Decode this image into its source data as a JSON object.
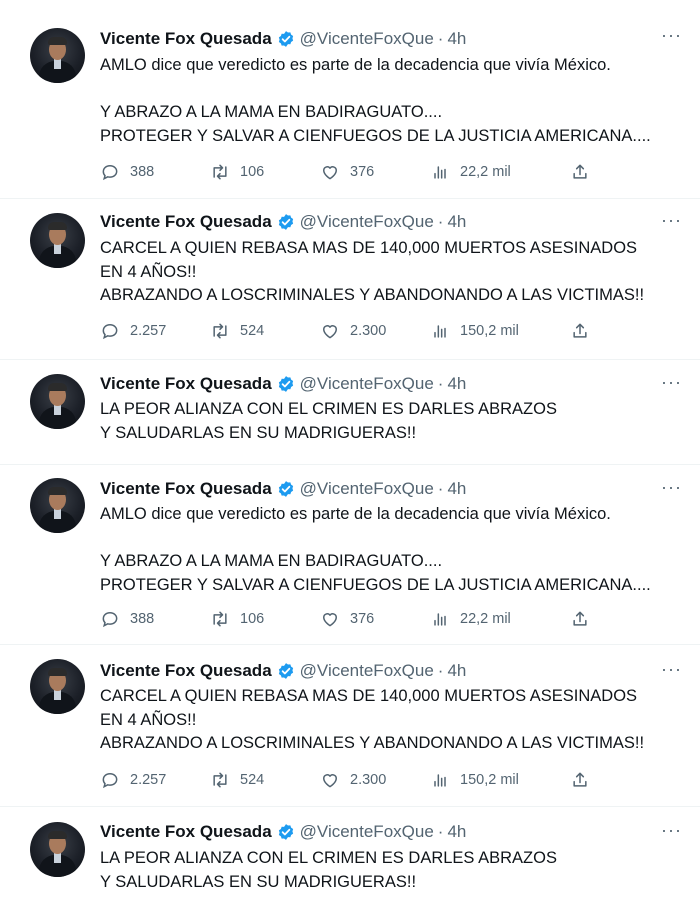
{
  "colors": {
    "text": "#0f1419",
    "muted": "#536471",
    "verified": "#1d9bf0",
    "divider": "#eff3f4"
  },
  "icons": {
    "reply": "speech-bubble-icon",
    "retweet": "retweet-arrows-icon",
    "like": "heart-icon",
    "views": "bar-chart-icon",
    "share": "share-upload-icon",
    "more": "more-dots-icon",
    "verified": "verified-badge-icon"
  },
  "tweets": [
    {
      "author": "Vicente Fox Quesada",
      "handle": "@VicenteFoxQue",
      "separator": "·",
      "time": "4h",
      "more": "···",
      "text": "AMLO dice que veredicto es parte de la decadencia que vivía México.\n\nY ABRAZO A LA MAMA EN BADIRAGUATO....\nPROTEGER Y SALVAR A CIENFUEGOS DE LA JUSTICIA AMERICANA....",
      "replies": "388",
      "retweets": "106",
      "likes": "376",
      "views": "22,2 mil"
    },
    {
      "author": "Vicente Fox Quesada",
      "handle": "@VicenteFoxQue",
      "separator": "·",
      "time": "4h",
      "more": "···",
      "text": "CARCEL A QUIEN REBASA MAS DE 140,000 MUERTOS ASESINADOS EN 4 AÑOS!!\nABRAZANDO A LOSCRIMINALES Y ABANDONANDO A LAS VICTIMAS!!",
      "replies": "2.257",
      "retweets": "524",
      "likes": "2.300",
      "views": "150,2 mil"
    },
    {
      "author": "Vicente Fox Quesada",
      "handle": "@VicenteFoxQue",
      "separator": "·",
      "time": "4h",
      "more": "···",
      "text": "LA PEOR ALIANZA CON EL CRIMEN ES DARLES ABRAZOS Y SALUDARLAS EN SU MADRIGUERAS!!"
    },
    {
      "author": "Vicente Fox Quesada",
      "handle": "@VicenteFoxQue",
      "separator": "·",
      "time": "4h",
      "more": "···",
      "text": "AMLO dice que veredicto es parte de la decadencia que vivía México.\n\nY ABRAZO A LA MAMA EN BADIRAGUATO....\nPROTEGER Y SALVAR A CIENFUEGOS DE LA JUSTICIA AMERICANA....",
      "replies": "388",
      "retweets": "106",
      "likes": "376",
      "views": "22,2 mil"
    },
    {
      "author": "Vicente Fox Quesada",
      "handle": "@VicenteFoxQue",
      "separator": "·",
      "time": "4h",
      "more": "···",
      "text": "CARCEL A QUIEN REBASA MAS DE 140,000 MUERTOS ASESINADOS EN 4 AÑOS!!\nABRAZANDO A LOSCRIMINALES Y ABANDONANDO A LAS VICTIMAS!!",
      "replies": "2.257",
      "retweets": "524",
      "likes": "2.300",
      "views": "150,2 mil"
    },
    {
      "author": "Vicente Fox Quesada",
      "handle": "@VicenteFoxQue",
      "separator": "·",
      "time": "4h",
      "more": "···",
      "text": "LA PEOR ALIANZA CON EL CRIMEN ES DARLES ABRAZOS Y SALUDARLAS EN SU MADRIGUERAS!!"
    }
  ]
}
